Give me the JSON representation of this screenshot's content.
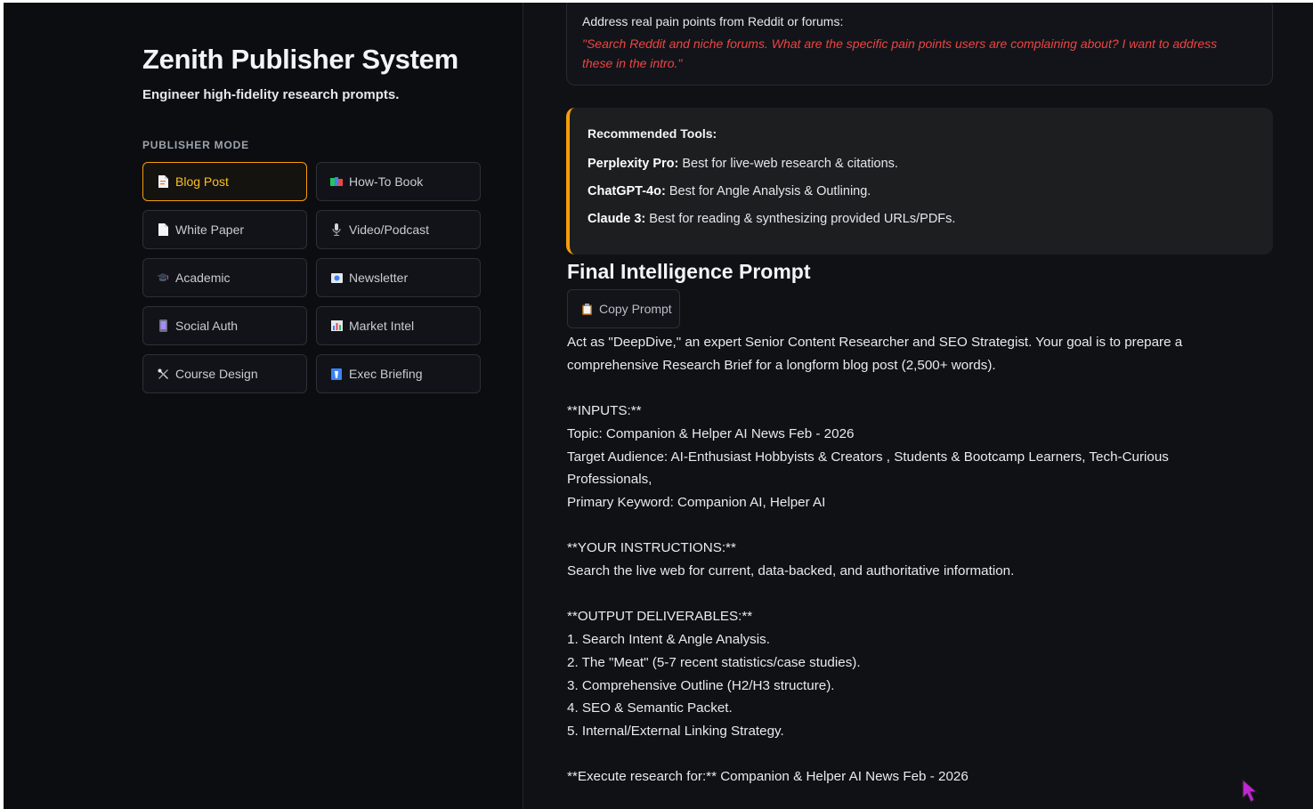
{
  "sidebar": {
    "title": "Zenith Publisher System",
    "subtitle": "Engineer high-fidelity research prompts.",
    "section_label": "PUBLISHER MODE",
    "modes": [
      {
        "label": "Blog Post",
        "icon": "document-icon",
        "active": true
      },
      {
        "label": "How-To Book",
        "icon": "books-icon",
        "active": false
      },
      {
        "label": "White Paper",
        "icon": "page-icon",
        "active": false
      },
      {
        "label": "Video/Podcast",
        "icon": "microphone-icon",
        "active": false
      },
      {
        "label": "Academic",
        "icon": "graduation-cap-icon",
        "active": false
      },
      {
        "label": "Newsletter",
        "icon": "newsletter-icon",
        "active": false
      },
      {
        "label": "Social Auth",
        "icon": "phone-icon",
        "active": false
      },
      {
        "label": "Market Intel",
        "icon": "bar-chart-icon",
        "active": false
      },
      {
        "label": "Course Design",
        "icon": "tools-icon",
        "active": false
      },
      {
        "label": "Exec Briefing",
        "icon": "briefing-icon",
        "active": false
      }
    ]
  },
  "main": {
    "pain_points": {
      "label": "Address real pain points from Reddit or forums:",
      "quote": "\"Search Reddit and niche forums. What are the specific pain points users are complaining about? I want to address these in the intro.\""
    },
    "tools": {
      "title": "Recommended Tools:",
      "items": [
        {
          "name": "Perplexity Pro:",
          "desc": " Best for live-web research & citations."
        },
        {
          "name": "ChatGPT-4o:",
          "desc": " Best for Angle Analysis & Outlining."
        },
        {
          "name": "Claude 3:",
          "desc": " Best for reading & synthesizing provided URLs/PDFs."
        }
      ]
    },
    "final_title": "Final Intelligence Prompt",
    "copy_label": "Copy Prompt",
    "prompt": "Act as \"DeepDive,\" an expert Senior Content Researcher and SEO Strategist. Your goal is to prepare a comprehensive Research Brief for a longform blog post (2,500+ words).\n\n**INPUTS:**\nTopic: Companion & Helper AI News Feb - 2026\nTarget Audience: AI-Enthusiast Hobbyists & Creators , Students & Bootcamp Learners, Tech-Curious Professionals,\nPrimary Keyword: Companion AI, Helper AI\n\n**YOUR INSTRUCTIONS:**\nSearch the live web for current, data-backed, and authoritative information.\n\n**OUTPUT DELIVERABLES:**\n1. Search Intent & Angle Analysis.\n2. The \"Meat\" (5-7 recent statistics/case studies).\n3. Comprehensive Outline (H2/H3 structure).\n4. SEO & Semantic Packet.\n5. Internal/External Linking Strategy.\n\n**Execute research for:** Companion & Helper AI News Feb - 2026"
  },
  "colors": {
    "accent": "#f59e0b",
    "quote": "#ef4444",
    "background": "#0f1115",
    "sidebar": "#0c0d10",
    "cursor": "#c026d3"
  }
}
